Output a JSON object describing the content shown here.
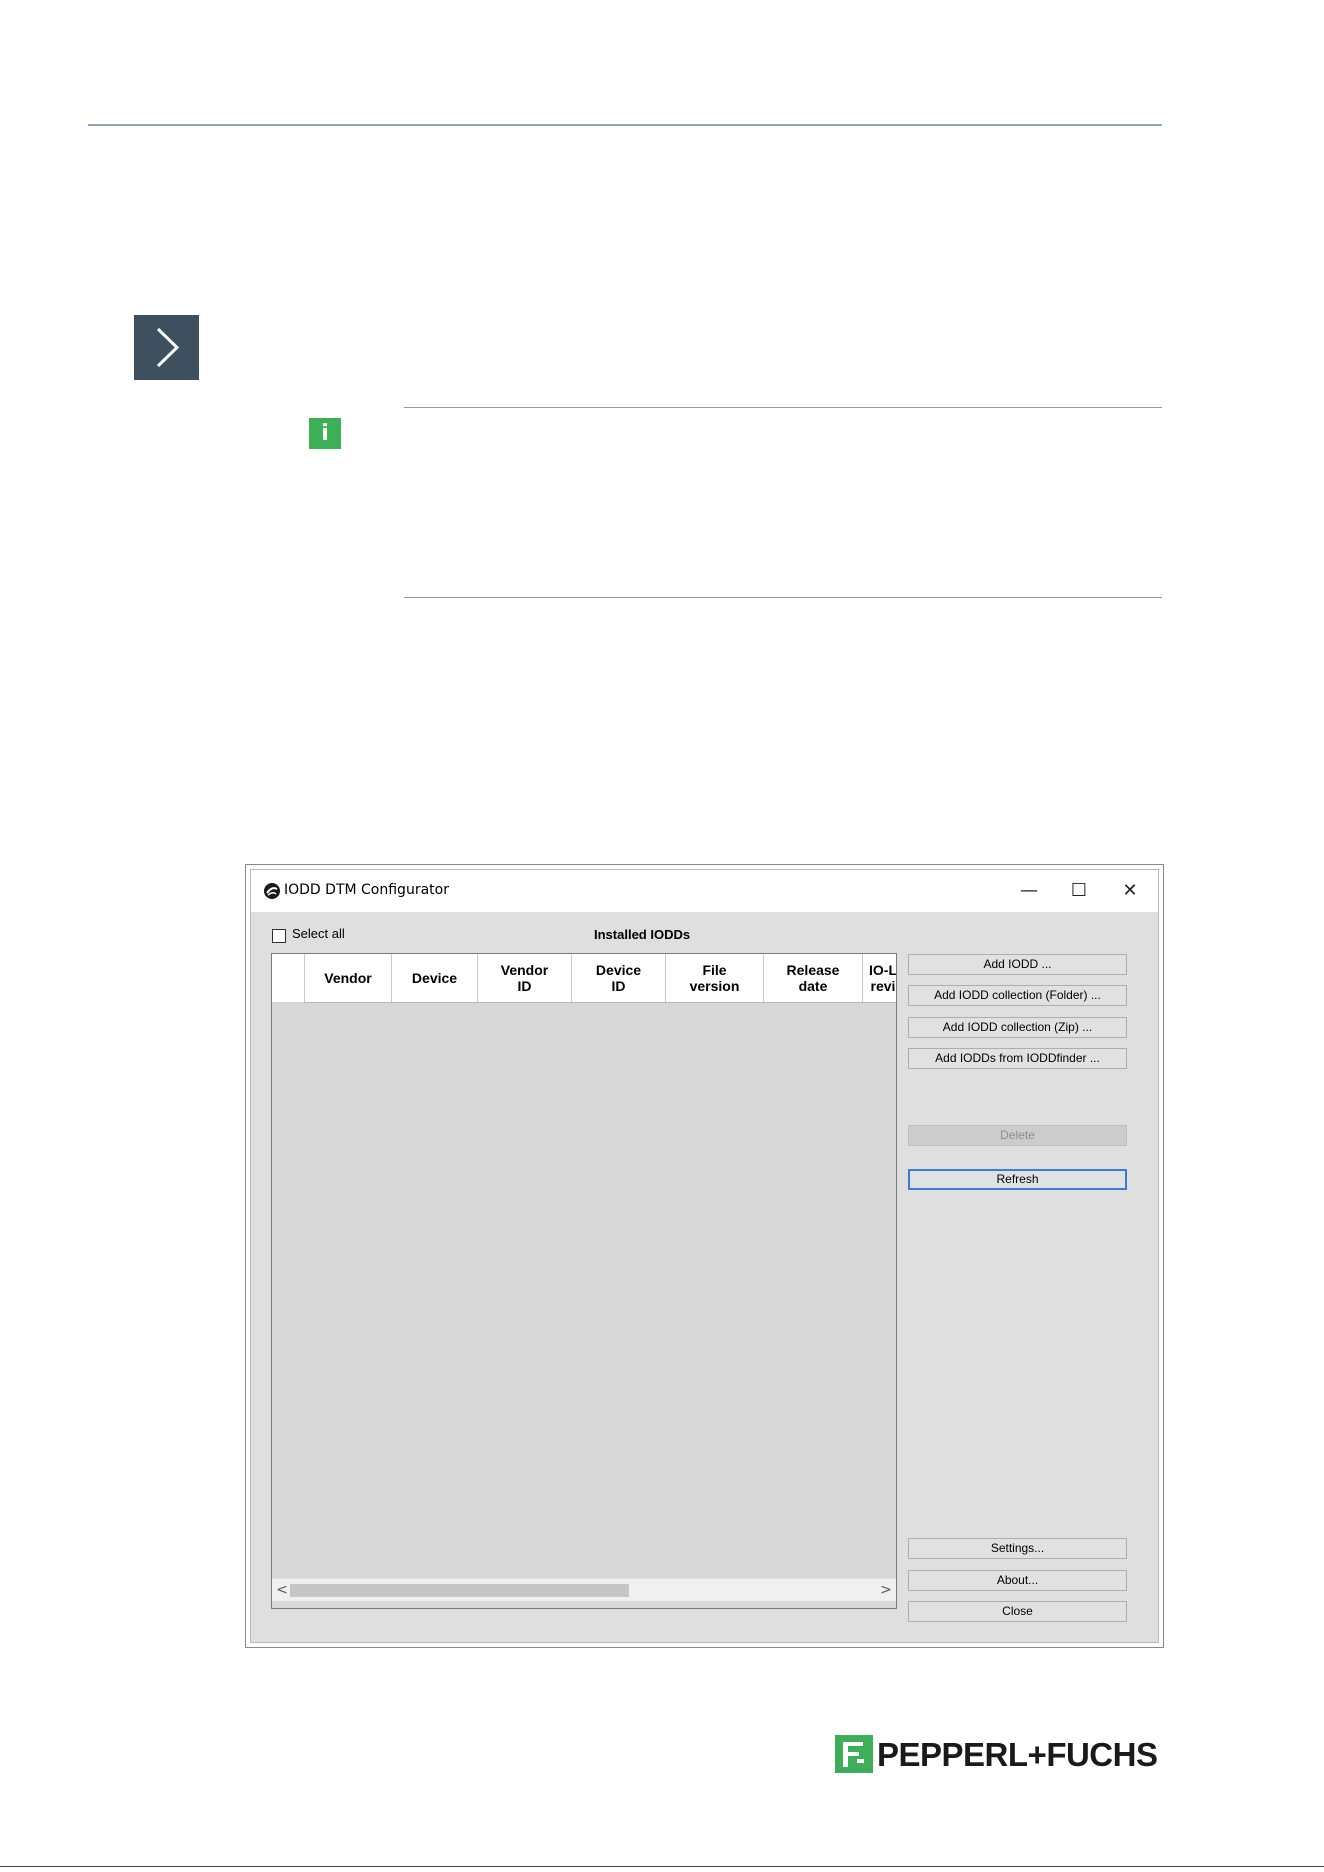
{
  "window": {
    "title": "IODD DTM Configurator",
    "controls": {
      "minimize": "—",
      "maximize": "☐",
      "close": "✕"
    }
  },
  "select_all": {
    "label": "Select all",
    "checked": false
  },
  "list_title": "Installed IODDs",
  "grid": {
    "columns": [
      "",
      "Vendor",
      "Device",
      "Vendor\nID",
      "Device\nID",
      "File\nversion",
      "Release\ndate",
      "IO-L\nrevi"
    ],
    "rows": [],
    "scroll_left": "<",
    "scroll_right": ">"
  },
  "buttons": {
    "add_iodd": "Add IODD ...",
    "add_folder": "Add IODD collection (Folder) ...",
    "add_zip": "Add IODD collection (Zip) ...",
    "add_finder": "Add IODDs from IODDfinder ...",
    "delete": "Delete",
    "refresh": "Refresh",
    "settings": "Settings...",
    "about": "About...",
    "close": "Close"
  },
  "brand": {
    "name": "PEPPERL+FUCHS",
    "color": "#3fae5a"
  },
  "icons": {
    "nav": "chevron-right-icon",
    "note": "info-icon",
    "app": "app-logo-icon"
  }
}
